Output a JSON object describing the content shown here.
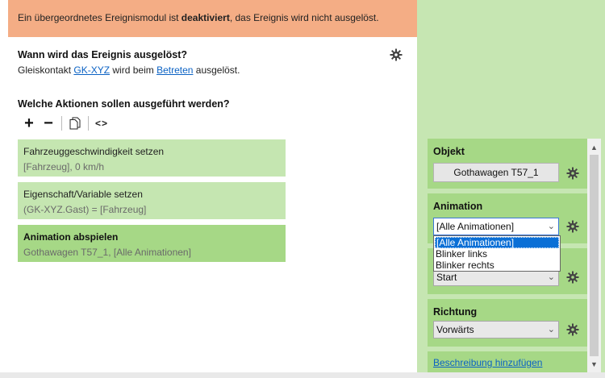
{
  "warning": {
    "prefix": "Ein übergeordnetes Ereignismodul ist ",
    "bold": "deaktiviert",
    "suffix": ", das Ereignis wird nicht ausgelöst."
  },
  "trigger": {
    "question": "Wann wird das Ereignis ausgelöst?",
    "part1": "Gleiskontakt ",
    "contact_link": "GK-XYZ",
    "part2": " wird beim ",
    "event_link": "Betreten",
    "part3": " ausgelöst."
  },
  "actions_section": {
    "question": "Welche Aktionen sollen ausgeführt werden?",
    "toolbar": {
      "add": "+",
      "remove": "−",
      "code": "<>"
    },
    "items": [
      {
        "title": "Fahrzeuggeschwindigkeit setzen",
        "subtitle": "[Fahrzeug], 0 km/h"
      },
      {
        "title": "Eigenschaft/Variable setzen",
        "subtitle": "(GK-XYZ.Gast) = [Fahrzeug]"
      },
      {
        "title": "Animation abspielen",
        "subtitle": "Gothawagen T57_1, [Alle Animationen]"
      }
    ]
  },
  "properties": {
    "objekt": {
      "title": "Objekt",
      "value": "Gothawagen T57_1"
    },
    "animation": {
      "title": "Animation",
      "selected": "[Alle Animationen]",
      "options": [
        "[Alle Animationen]",
        "Blinker links",
        "Blinker rechts"
      ]
    },
    "modus": {
      "selected": "Start"
    },
    "richtung": {
      "title": "Richtung",
      "selected": "Vorwärts"
    },
    "description_link": "Beschreibung hinzufügen"
  },
  "colors": {
    "warning_bg": "#f4ad85",
    "panel_green": "#a6d886",
    "light_green": "#c5e6b1",
    "link_blue": "#0b62c4",
    "selection_blue": "#0a6fd6"
  }
}
